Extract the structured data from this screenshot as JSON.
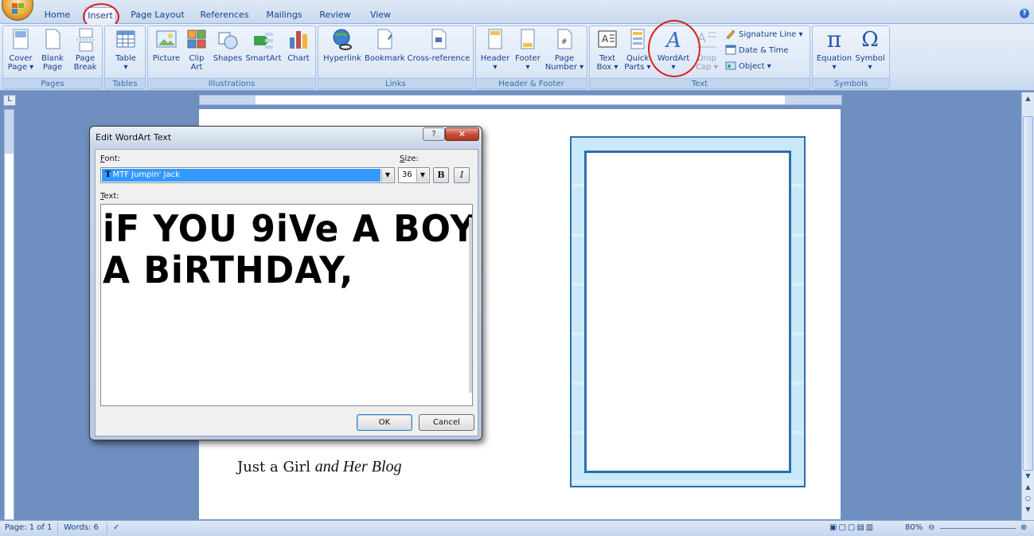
{
  "tabs": [
    "Home",
    "Insert",
    "Page Layout",
    "References",
    "Mailings",
    "Review",
    "View"
  ],
  "ribbon": {
    "pages": {
      "label": "Pages",
      "cover": "Cover",
      "cover2": "Page ▾",
      "blank": "Blank",
      "blank2": "Page",
      "break": "Page",
      "break2": "Break"
    },
    "tables": {
      "label": "Tables",
      "table": "Table",
      "table2": "▾"
    },
    "illustrations": {
      "label": "Illustrations",
      "picture": "Picture",
      "clip": "Clip",
      "clip2": "Art",
      "shapes": "Shapes",
      "smartart": "SmartArt",
      "chart": "Chart"
    },
    "links": {
      "label": "Links",
      "hyperlink": "Hyperlink",
      "bookmark": "Bookmark",
      "crossref": "Cross-reference"
    },
    "header_footer": {
      "label": "Header & Footer",
      "header": "Header",
      "header2": "▾",
      "footer": "Footer",
      "footer2": "▾",
      "pagenum": "Page",
      "pagenum2": "Number ▾"
    },
    "text": {
      "label": "Text",
      "textbox": "Text",
      "textbox2": "Box ▾",
      "quickparts": "Quick",
      "quickparts2": "Parts ▾",
      "wordart": "WordArt",
      "wordart2": "▾",
      "dropcap": "Drop",
      "dropcap2": "Cap ▾",
      "signature": "Signature Line ▾",
      "datetime": "Date & Time",
      "object": "Object ▾"
    },
    "symbols": {
      "label": "Symbols",
      "equation": "Equation",
      "equation2": "▾",
      "symbol": "Symbol",
      "symbol2": "▾"
    }
  },
  "dialog": {
    "title": "Edit WordArt Text",
    "font_label_u": "F",
    "font_label": "ont:",
    "font_value": "MTF Jumpin' Jack",
    "size_label_u": "S",
    "size_label": "ize:",
    "size_value": "36",
    "bold": "B",
    "italic": "I",
    "text_label_u": "T",
    "text_label": "ext:",
    "text_line1": "iF YOU 9iVe A BOY",
    "text_line2": "A BiRTHDAY,",
    "ok": "OK",
    "cancel": "Cancel",
    "help": "?",
    "close": "✕"
  },
  "document": {
    "signature_a": "Just a Girl",
    "signature_b": "and Her Blog"
  },
  "status": {
    "page": "Page: 1 of 1",
    "words": "Words: 6",
    "zoom": "80%"
  },
  "colors": {
    "accent": "#15428b",
    "highlight": "#d8201f",
    "frame": "#2f6da9"
  }
}
